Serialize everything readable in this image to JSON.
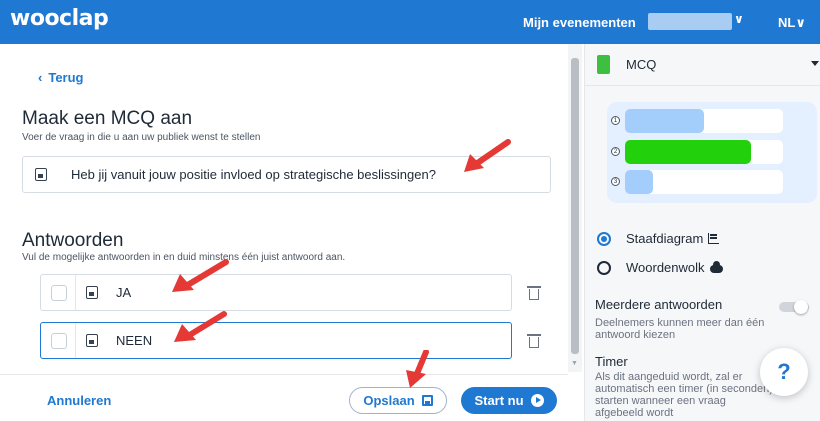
{
  "topbar": {
    "logo": "wooclap",
    "events_link": "Mijn evenementen",
    "user_chevron": "∨",
    "language": "NL∨"
  },
  "editor": {
    "back_label": "Terug",
    "back_chevron": "‹",
    "title": "Maak een MCQ aan",
    "subtitle": "Voer de vraag in die u aan uw publiek wenst te stellen",
    "question_value": "Heb jij vanuit jouw positie invloed op strategische beslissingen?",
    "answers_title": "Antwoorden",
    "answers_subtitle": "Vul de mogelijke antwoorden in en duid minstens één juist antwoord aan.",
    "answers": [
      "JA",
      "NEEN"
    ]
  },
  "footer": {
    "cancel": "Annuleren",
    "save": "Opslaan",
    "start": "Start nu"
  },
  "sidebar": {
    "question_type": "MCQ",
    "preview": {
      "numbers": [
        "1",
        "2",
        "3"
      ],
      "fill_fractions": [
        0.5,
        0.8,
        0.18
      ],
      "colors": [
        "#a3cdfb",
        "#22d10c",
        "#a3cdfb"
      ]
    },
    "display_options": [
      {
        "label": "Staafdiagram",
        "selected": true,
        "icon": "bar-chart-icon"
      },
      {
        "label": "Woordenwolk",
        "selected": false,
        "icon": "cloud-icon"
      }
    ],
    "multiple_answers_title": "Meerdere antwoorden",
    "multiple_answers_desc": "Deelnemers kunnen meer dan één antwoord kiezen",
    "timer_title": "Timer",
    "timer_desc": "Als dit aangeduid wordt, zal er automatisch een timer (in seconden) starten wanneer een vraag afgebeeld wordt"
  },
  "help_label": "?",
  "colors": {
    "brand": "#1f78d1",
    "annotation_arrow": "#e53935",
    "correct_bar": "#22d10c"
  }
}
